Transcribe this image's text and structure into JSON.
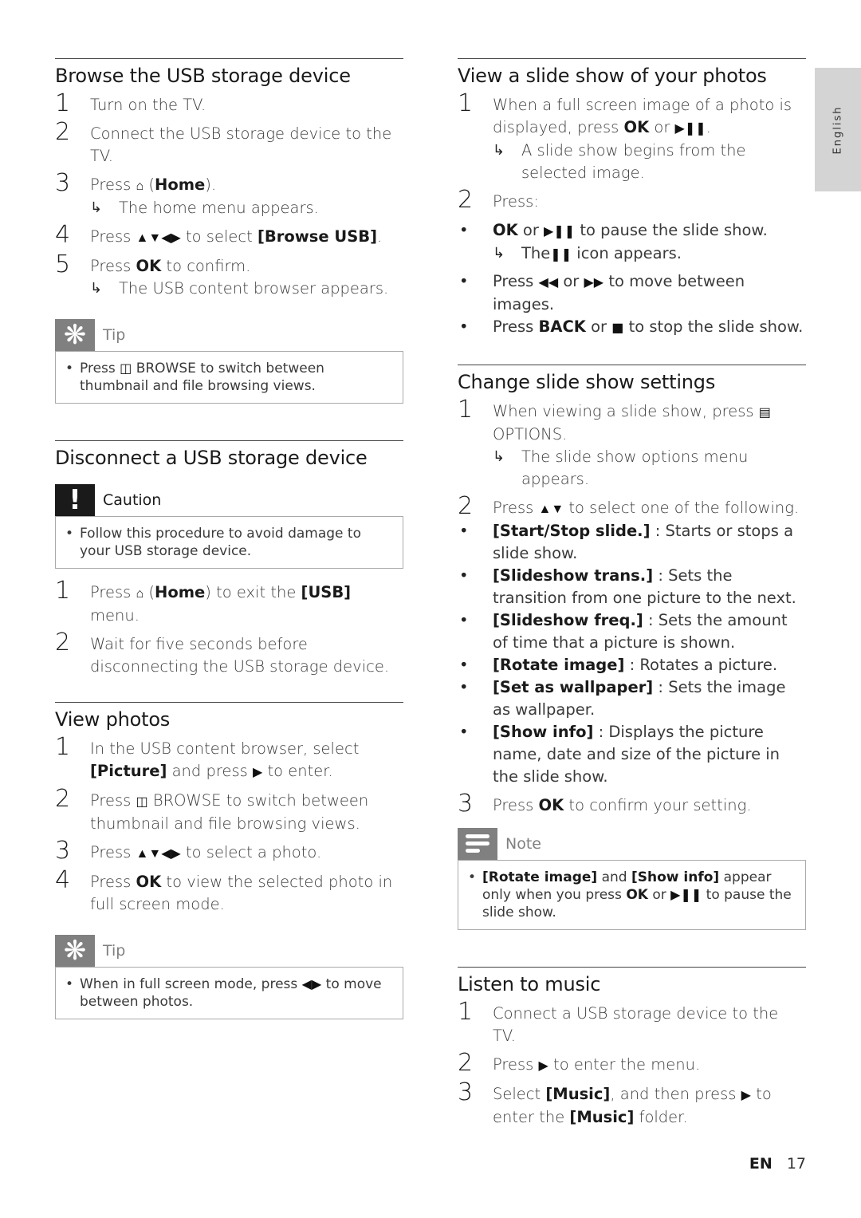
{
  "lang_tab": "English",
  "footer": {
    "lang": "EN",
    "page": "17"
  },
  "left": {
    "browse": {
      "title": "Browse the USB storage device",
      "steps": [
        {
          "num": "1",
          "text": "Turn on the TV."
        },
        {
          "num": "2",
          "text": "Connect the USB storage device to the TV."
        },
        {
          "num": "3",
          "pre": "Press",
          "icon": "home-icon",
          "mid": "(",
          "bold": "Home",
          "post": ").",
          "result": "The home menu appears."
        },
        {
          "num": "4",
          "pre": "Press",
          "icon": "nav-arrows-icon",
          "mid": "to select",
          "bold": "[Browse USB]",
          "post": "."
        },
        {
          "num": "5",
          "pre": "Press",
          "bold": "OK",
          "post": "to confirm.",
          "result": "The USB content browser appears."
        }
      ],
      "tip": {
        "title": "Tip",
        "pre": "Press",
        "icon": "browse-icon",
        "text": "BROWSE to switch between thumbnail and file browsing views."
      }
    },
    "disconnect": {
      "title": "Disconnect a USB storage device",
      "caution": {
        "title": "Caution",
        "text": "Follow this procedure to avoid damage to your USB storage device."
      },
      "steps": [
        {
          "num": "1",
          "pre": "Press",
          "icon": "home-icon",
          "mid": "(",
          "bold": "Home",
          "mid2": ") to exit the",
          "bold2": "[USB]",
          "post": "menu."
        },
        {
          "num": "2",
          "text": "Wait for five seconds before disconnecting the USB storage device."
        }
      ]
    },
    "view_photos": {
      "title": "View photos",
      "steps": [
        {
          "num": "1",
          "pre": "In the USB content browser, select",
          "bold": "[Picture]",
          "mid": "and press",
          "icon": "right-arrow-icon",
          "post": "to enter."
        },
        {
          "num": "2",
          "pre": "Press",
          "icon": "browse-icon",
          "post": "BROWSE to switch between thumbnail and file browsing views."
        },
        {
          "num": "3",
          "pre": "Press",
          "icon": "nav-arrows-icon",
          "post": "to select a photo."
        },
        {
          "num": "4",
          "pre": "Press",
          "bold": "OK",
          "post": "to view the selected photo in full screen mode."
        }
      ],
      "tip": {
        "title": "Tip",
        "pre": "When in full screen mode, press",
        "icon": "left-right-icon",
        "text": "to move between photos."
      }
    }
  },
  "right": {
    "slideshow": {
      "title": "View a slide show of your photos",
      "step1": {
        "num": "1",
        "pre": "When a full screen image of a photo is displayed, press",
        "bold": "OK",
        "mid": "or",
        "post": ".",
        "result": "A slide show begins from the selected image."
      },
      "step2": {
        "num": "2",
        "text": "Press:",
        "bullets": [
          {
            "bold": "OK",
            "mid": "or",
            "post": "to pause the slide show.",
            "result_pre": "The",
            "result_post": "icon appears."
          },
          {
            "pre": "Press",
            "mid": "or",
            "post": "to move between images."
          },
          {
            "pre": "Press",
            "bold": "BACK",
            "mid": "or",
            "post": "to stop the slide show."
          }
        ]
      }
    },
    "settings": {
      "title": "Change slide show settings",
      "step1": {
        "num": "1",
        "pre": "When viewing a slide show, press",
        "post": "OPTIONS.",
        "result": "The slide show options menu appears."
      },
      "step2": {
        "num": "2",
        "pre": "Press",
        "post": "to select one of the following.",
        "options": [
          {
            "name": "[Start/Stop slide.]",
            "desc": ": Starts or stops a slide show."
          },
          {
            "name": "[Slideshow trans.]",
            "desc": ": Sets the transition from one picture to the next."
          },
          {
            "name": "[Slideshow freq.]",
            "desc": ": Sets the amount of time that a picture is shown."
          },
          {
            "name": "[Rotate image]",
            "desc": ": Rotates a picture."
          },
          {
            "name": "[Set as wallpaper]",
            "desc": ": Sets the image as wallpaper."
          },
          {
            "name": "[Show info]",
            "desc": ": Displays the picture name, date and size of the picture in the slide show."
          }
        ]
      },
      "step3": {
        "num": "3",
        "pre": "Press",
        "bold": "OK",
        "post": "to confirm your setting."
      },
      "note": {
        "title": "Note",
        "b1": "[Rotate image]",
        "t1": "and",
        "b2": "[Show info]",
        "t2": "appear only when you press",
        "b3": "OK",
        "t3": "or",
        "t4": "to pause the slide show."
      }
    },
    "music": {
      "title": "Listen to music",
      "steps": [
        {
          "num": "1",
          "text": "Connect a USB storage device to the TV."
        },
        {
          "num": "2",
          "pre": "Press",
          "post": "to enter the menu."
        },
        {
          "num": "3",
          "pre": "Select",
          "bold": "[Music]",
          "mid": ", and then press",
          "post": "to enter the",
          "bold2": "[Music]",
          "post2": "folder."
        }
      ]
    }
  }
}
